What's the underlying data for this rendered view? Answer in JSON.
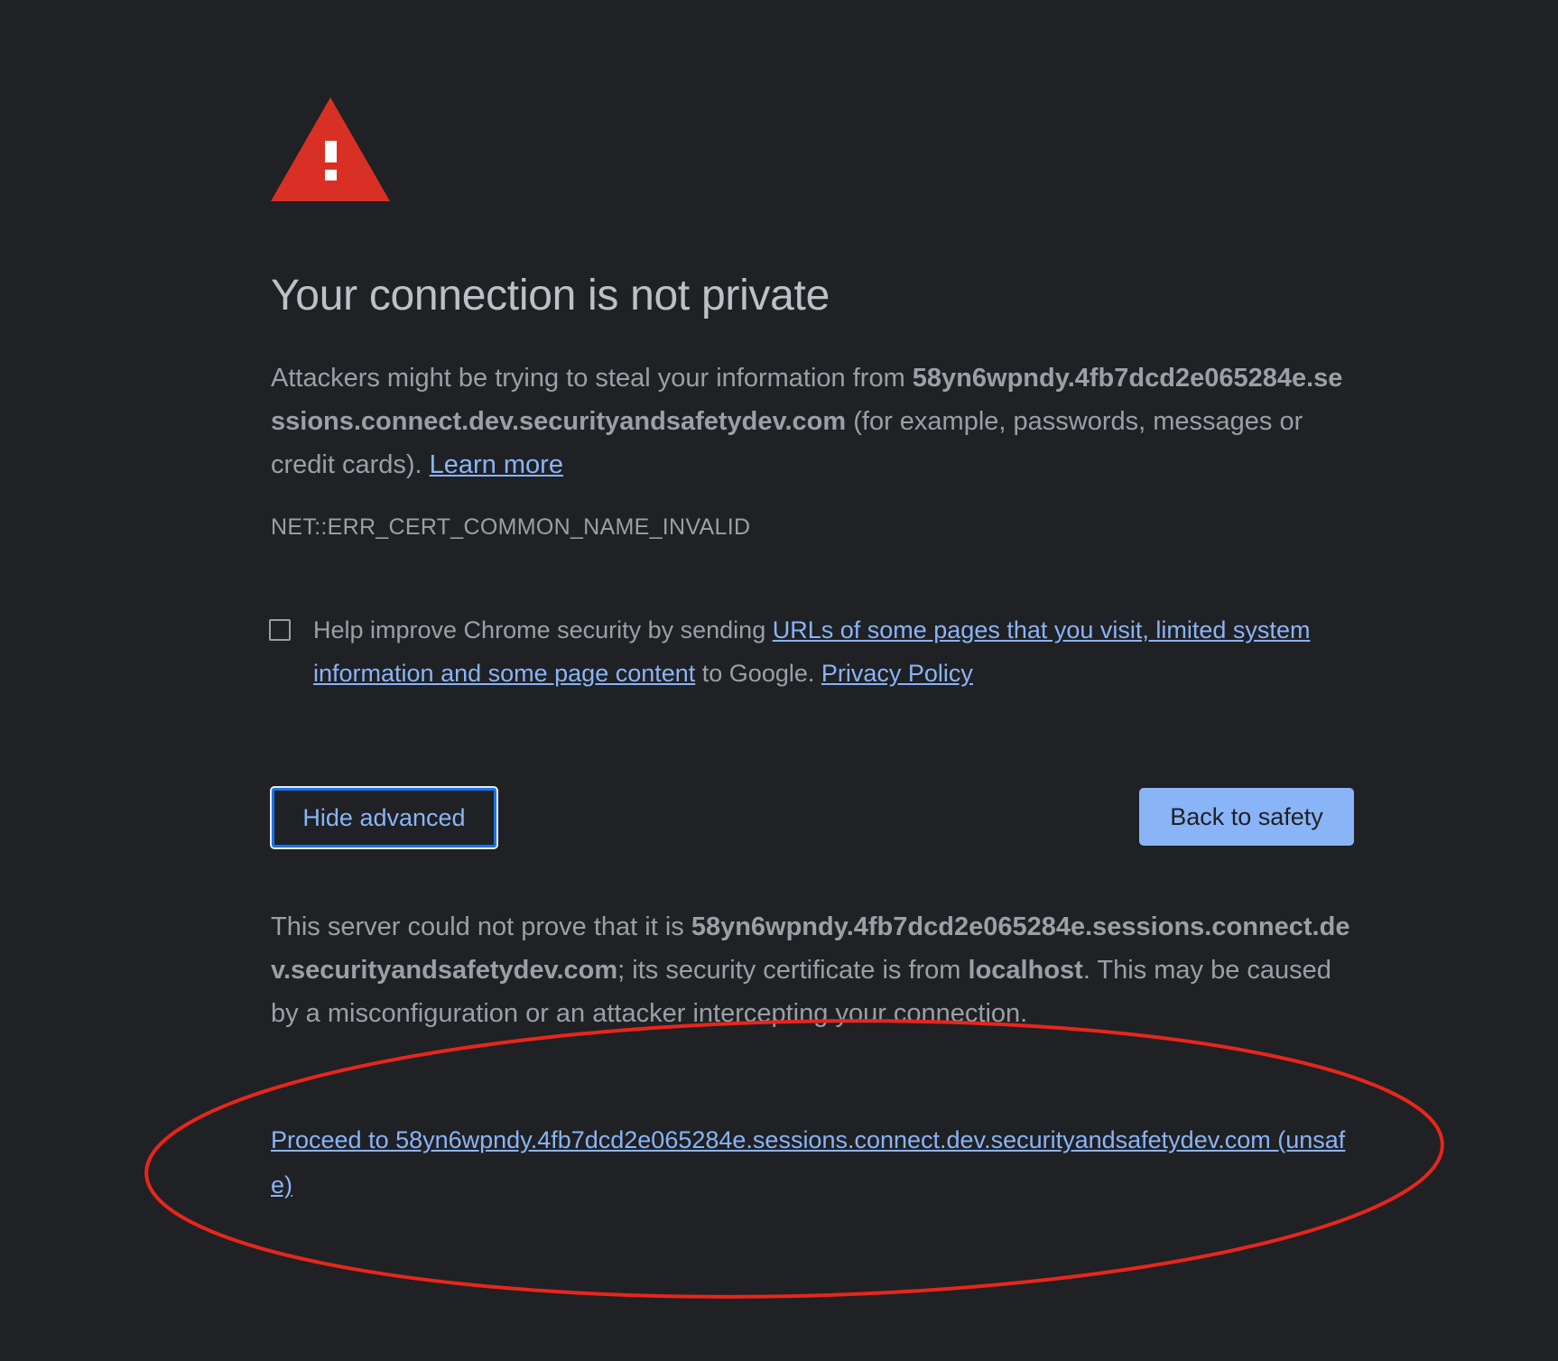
{
  "interstitial": {
    "title": "Your connection is not private",
    "intro_before": "Attackers might be trying to steal your information from ",
    "host": "58yn6wpndy.4fb7dcd2e065284e.sessions.connect.dev.securityandsafetydev.com",
    "intro_after": " (for example, passwords, messages or credit cards). ",
    "learn_more": "Learn more",
    "error_code": "NET::ERR_CERT_COMMON_NAME_INVALID"
  },
  "reporting": {
    "checked": false,
    "text_before": "Help improve Chrome security by sending ",
    "link_text": "URLs of some pages that you visit, limited system information and some page content",
    "text_middle": " to Google. ",
    "privacy_policy": "Privacy Policy"
  },
  "buttons": {
    "hide_advanced": "Hide advanced",
    "back_to_safety": "Back to safety"
  },
  "details": {
    "text_before": "This server could not prove that it is ",
    "host": "58yn6wpndy.4fb7dcd2e065284e.sessions.connect.dev.securityandsafetydev.com",
    "text_middle": "; its security certificate is from ",
    "issuer": "localhost",
    "text_after": ". This may be caused by a misconfiguration or an attacker intercepting your connection.",
    "proceed_link": "Proceed to 58yn6wpndy.4fb7dcd2e065284e.sessions.connect.dev.securityandsafetydev.com (unsafe)"
  },
  "colors": {
    "background": "#202124",
    "body_text": "#9aa0a6",
    "title_text": "#bdc1c6",
    "link": "#8ab4f8",
    "primary_button": "#8ab4f8",
    "warning_icon": "#d93025",
    "annotation_ellipse": "#e8261c"
  },
  "icons": {
    "warning": "warning-triangle-icon"
  }
}
